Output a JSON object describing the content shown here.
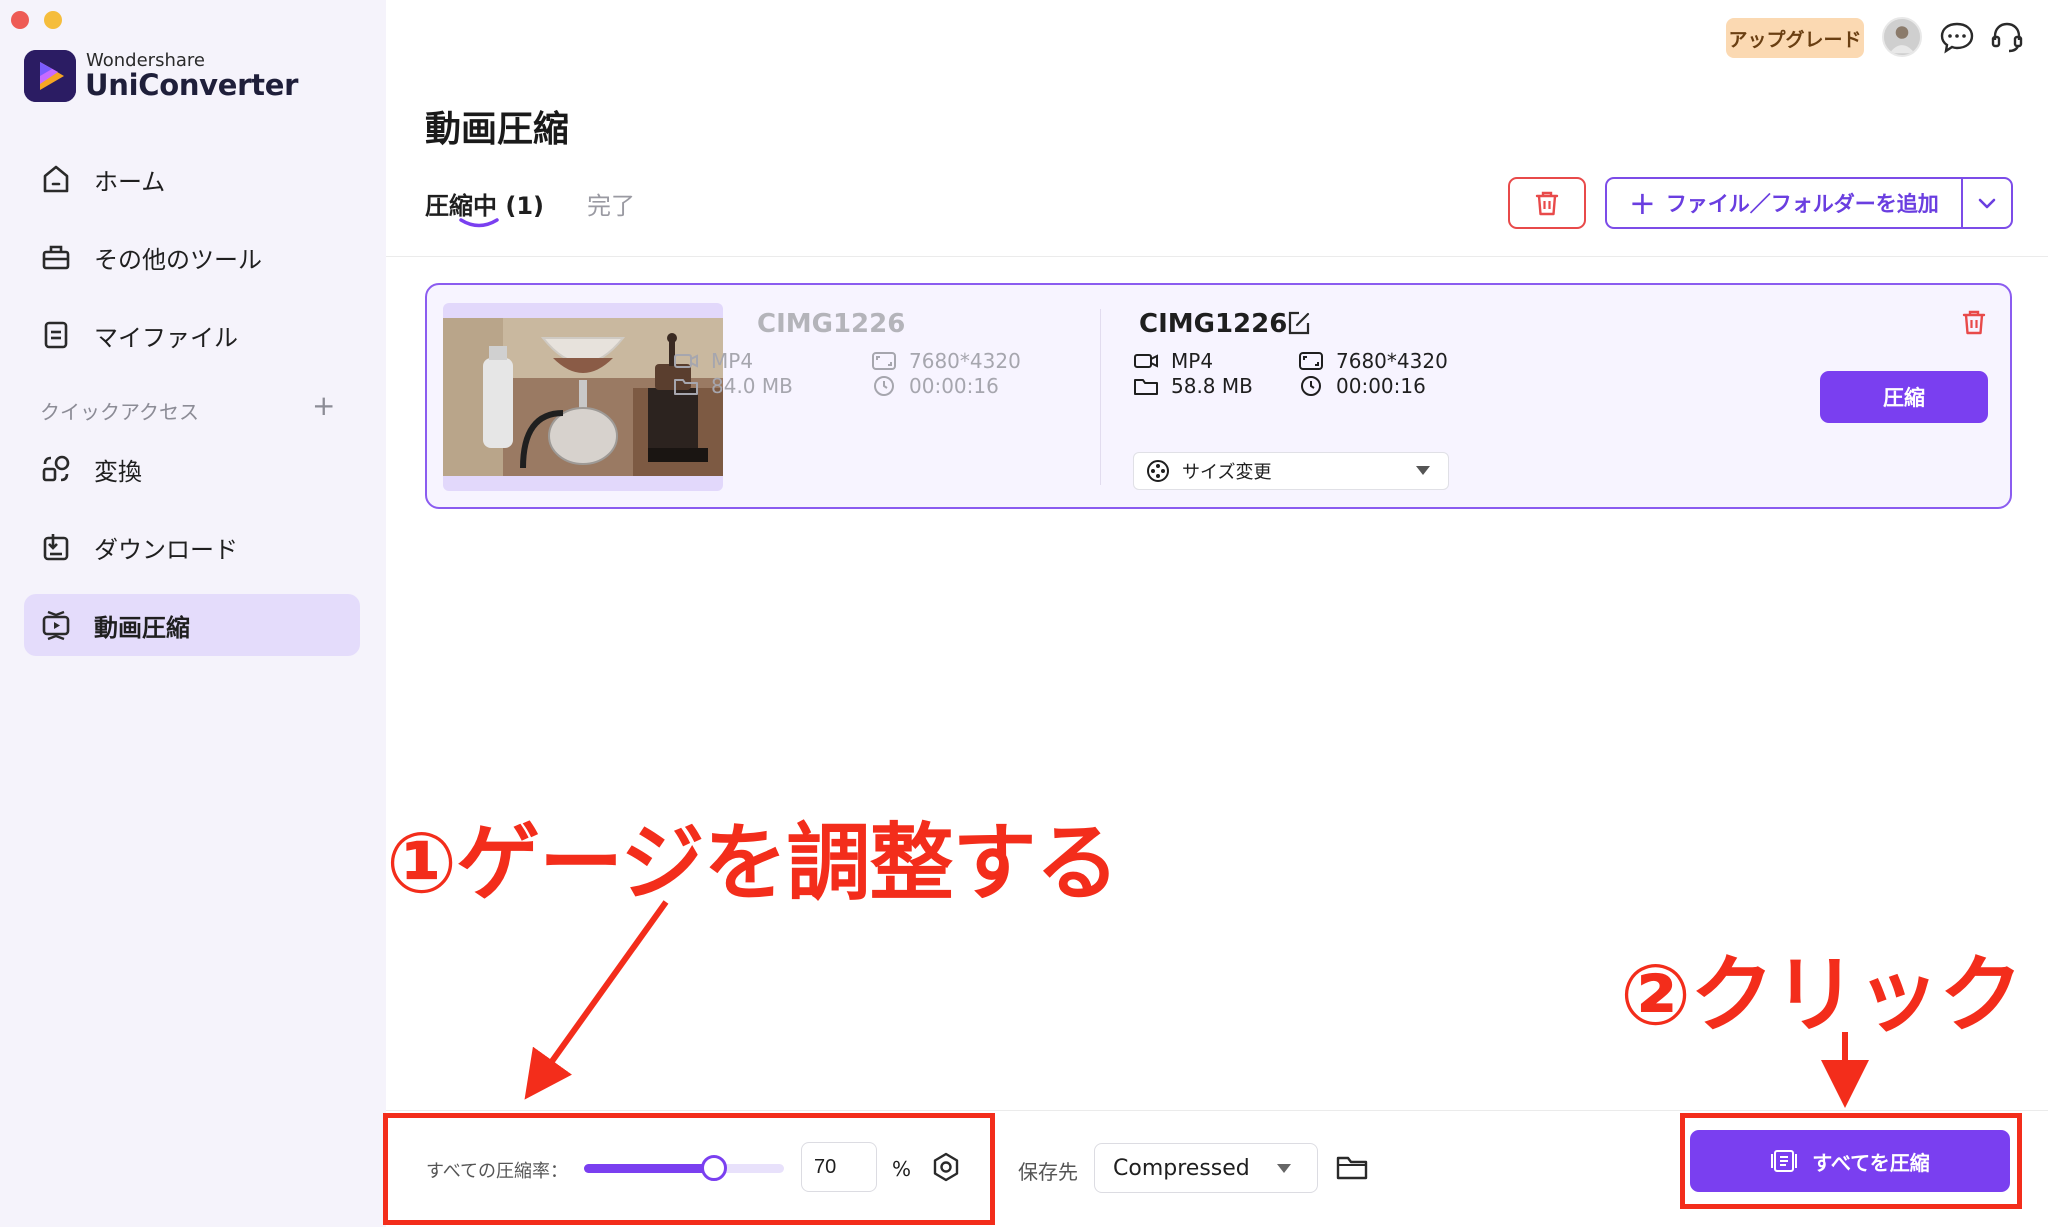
{
  "app": {
    "brand_small": "Wondershare",
    "brand_name": "UniConverter"
  },
  "sidebar": {
    "items": [
      {
        "label": "ホーム",
        "icon": "home-icon"
      },
      {
        "label": "その他のツール",
        "icon": "toolbox-icon"
      },
      {
        "label": "マイファイル",
        "icon": "file-icon"
      }
    ],
    "quick_access_label": "クイックアクセス",
    "quick_items": [
      {
        "label": "変換",
        "icon": "convert-icon"
      },
      {
        "label": "ダウンロード",
        "icon": "download-icon"
      },
      {
        "label": "動画圧縮",
        "icon": "video-compress-icon",
        "active": true
      }
    ]
  },
  "topbar": {
    "upgrade_label": "アップグレード",
    "icons": [
      "avatar",
      "chat-icon",
      "support-headset-icon"
    ]
  },
  "main": {
    "title": "動画圧縮",
    "tabs": [
      {
        "label": "圧縮中 (1)",
        "active": true
      },
      {
        "label": "完了",
        "active": false
      }
    ],
    "add_button_label": "ファイル／フォルダーを追加"
  },
  "file_card": {
    "source": {
      "name": "CIMG1226",
      "format": "MP4",
      "size": "84.0 MB",
      "resolution": "7680*4320",
      "duration": "00:00:16"
    },
    "output": {
      "name": "CIMG1226",
      "format": "MP4",
      "size": "58.8 MB",
      "resolution": "7680*4320",
      "duration": "00:00:16"
    },
    "resize_option": "サイズ変更",
    "compress_label": "圧縮"
  },
  "bottom_bar": {
    "ratio_label": "すべての圧縮率：",
    "ratio_fraction": 0.65,
    "ratio_value": "70",
    "ratio_unit": "%",
    "save_label": "保存先",
    "save_folder": "Compressed",
    "compress_all_label": "すべてを圧縮"
  },
  "annotations": {
    "step1": "①ゲージを調整する",
    "step2": "②クリック"
  },
  "colors": {
    "accent": "#7a3ff0",
    "annotation": "#f32d1b",
    "danger": "#e84a4a",
    "sidebar_bg": "#f5f3fb"
  }
}
